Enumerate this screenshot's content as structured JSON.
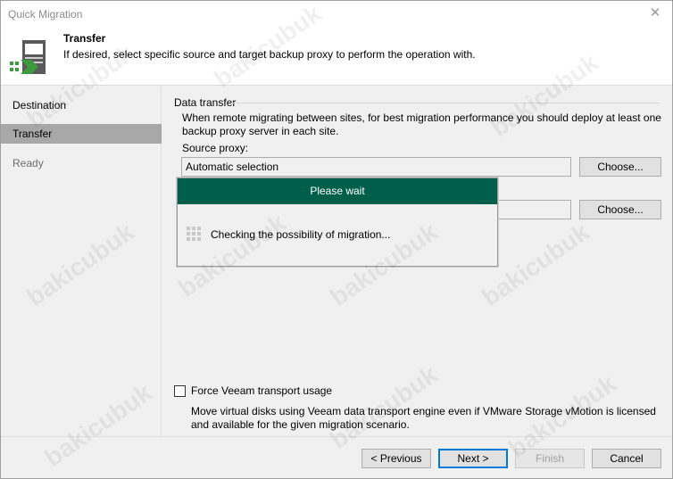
{
  "window": {
    "title": "Quick Migration"
  },
  "header": {
    "title": "Transfer",
    "description": "If desired, select specific source and target backup proxy to perform the operation with."
  },
  "sidebar": {
    "items": [
      {
        "label": "Destination",
        "state": "normal"
      },
      {
        "label": "Transfer",
        "state": "active"
      },
      {
        "label": "Ready",
        "state": "disabled"
      }
    ]
  },
  "data_transfer": {
    "group_label": "Data transfer",
    "description": "When remote migrating between sites, for best migration performance you should deploy at least one backup proxy server in each site.",
    "source_proxy_label": "Source proxy:",
    "source_proxy_value": "Automatic selection",
    "target_proxy_value": "",
    "choose_label": "Choose..."
  },
  "force_transport": {
    "checked": false,
    "label": "Force Veeam transport usage",
    "description": "Move virtual disks using Veeam data transport engine even if VMware Storage vMotion is licensed and available for the given migration scenario."
  },
  "footer": {
    "previous_label": "< Previous",
    "next_label": "Next >",
    "finish_label": "Finish",
    "cancel_label": "Cancel"
  },
  "wait_dialog": {
    "title": "Please wait",
    "message": "Checking the possibility of migration..."
  },
  "watermark": {
    "text": "bakicubuk"
  },
  "colors": {
    "accent": "#005f4b",
    "primary_border": "#0078d7",
    "active_nav": "#a8a8a8"
  }
}
